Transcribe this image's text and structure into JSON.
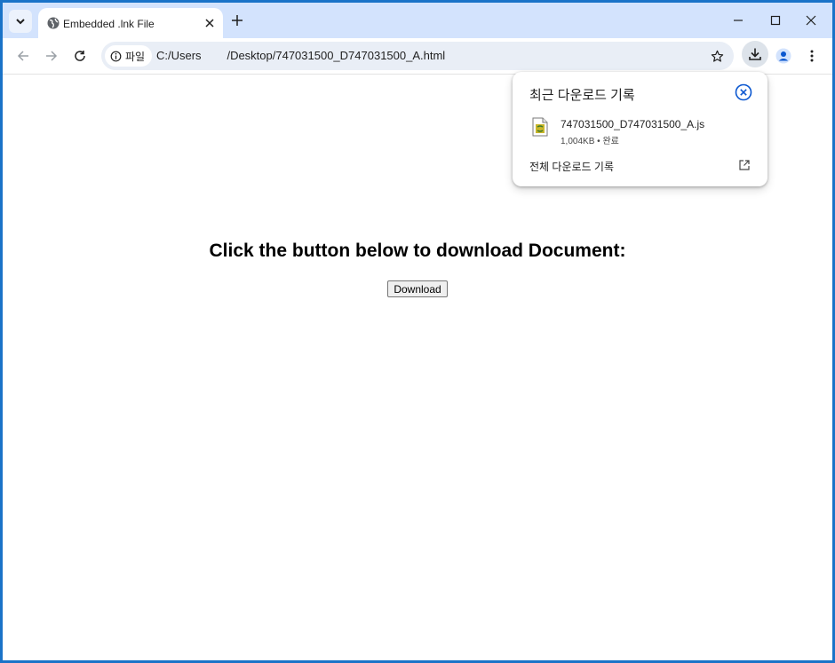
{
  "tab": {
    "title": "Embedded .lnk File"
  },
  "toolbar": {
    "site_chip_label": "파일",
    "url": "C:/Users        /Desktop/747031500_D747031500_A.html"
  },
  "page": {
    "heading": "Click the button below to download Document:",
    "button_label": "Download"
  },
  "downloads_bubble": {
    "title": "최근 다운로드 기록",
    "file_name": "747031500_D747031500_A.js",
    "file_size": "1,004KB",
    "separator": "•",
    "file_status": "완료",
    "all_downloads_label": "전체 다운로드 기록"
  },
  "colors": {
    "accent": "#1a73c8",
    "tabstrip": "#d3e3fd",
    "omnibox": "#e9eef6",
    "close_circle": "#0b57d0"
  },
  "icons": [
    "tab-search-icon",
    "globe-icon",
    "close-icon",
    "plus-icon",
    "minimize-icon",
    "maximize-icon",
    "back-arrow-icon",
    "forward-arrow-icon",
    "reload-icon",
    "info-icon",
    "star-icon",
    "download-icon",
    "profile-icon",
    "more-vert-icon",
    "script-file-icon",
    "open-external-icon"
  ]
}
